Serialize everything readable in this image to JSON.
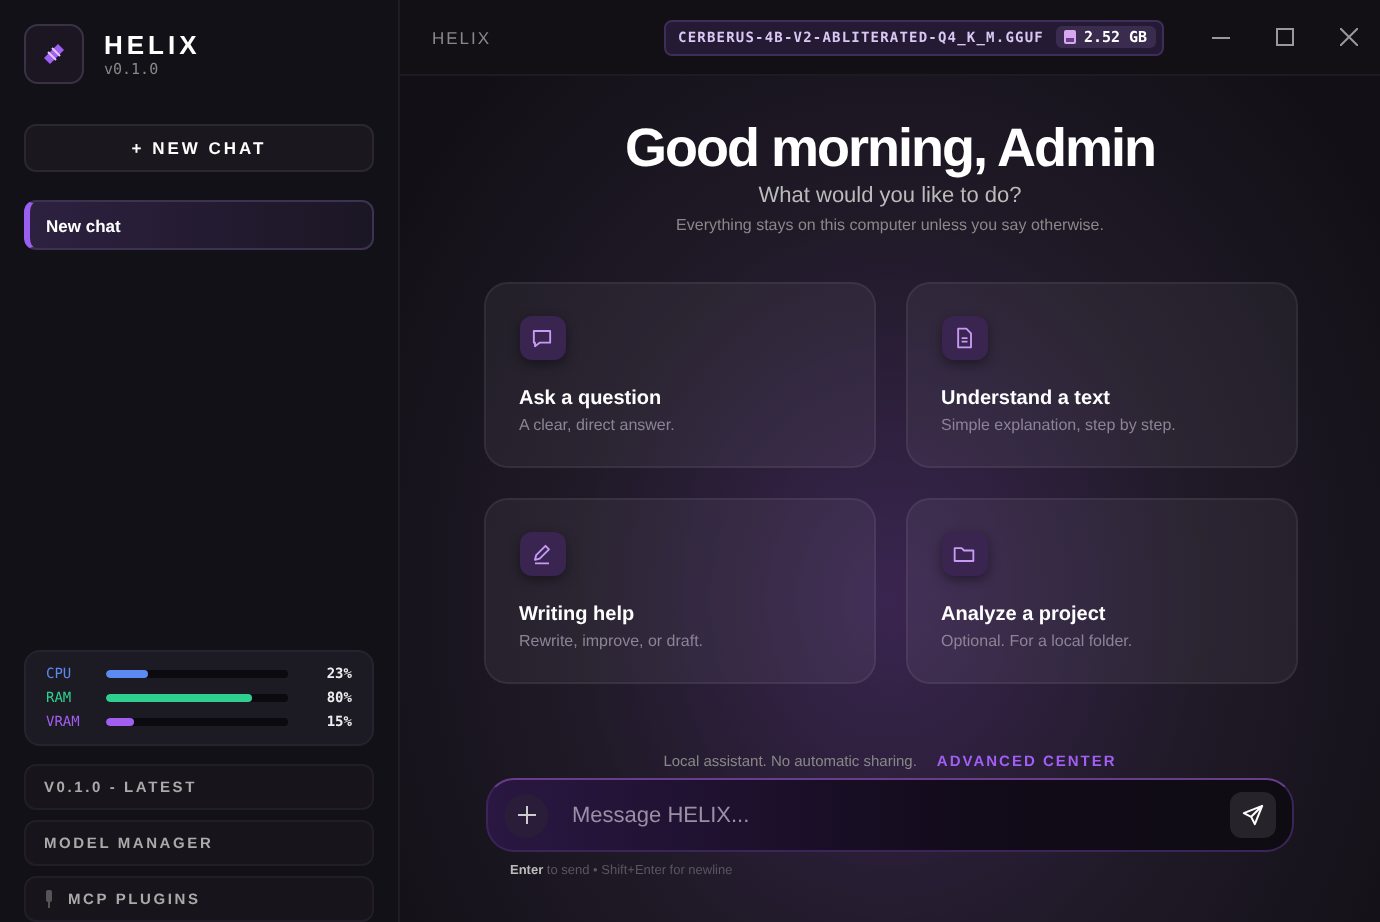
{
  "app": {
    "name": "HELIX",
    "version": "v0.1.0"
  },
  "sidebar": {
    "new_chat_button": "+ NEW CHAT",
    "chats": [
      {
        "title": "New chat",
        "selected": true
      }
    ],
    "resources": [
      {
        "name": "CPU",
        "level": 0.23,
        "reading": "23%",
        "color": "#5b8af0"
      },
      {
        "name": "RAM",
        "level": 0.8,
        "reading": "80%",
        "color": "#2fd08f"
      },
      {
        "name": "VRAM",
        "level": 0.15,
        "reading": "15%",
        "color": "#a15ef0"
      }
    ],
    "links": [
      {
        "label": "V0.1.0 - LATEST",
        "kind": "plain"
      },
      {
        "label": "MODEL MANAGER",
        "kind": "plain"
      },
      {
        "label": "MCP PLUGINS",
        "kind": "plugin"
      }
    ]
  },
  "titlebar": {
    "title": "HELIX",
    "model": "CERBERUS-4B-V2-ABLITERATED-Q4_K_M.GGUF",
    "model_size": "2.52 GB"
  },
  "greeting": {
    "title": "Good morning, Admin",
    "subtitle": "What would you like to do?",
    "note": "Everything stays on this computer unless you say otherwise."
  },
  "cards": [
    {
      "kind": "chat",
      "title": "Ask a question",
      "subtitle": "A clear, direct answer."
    },
    {
      "kind": "document",
      "title": "Understand a text",
      "subtitle": "Simple explanation, step by step."
    },
    {
      "kind": "pencil",
      "title": "Writing help",
      "subtitle": "Rewrite, improve, or draft."
    },
    {
      "kind": "folder",
      "title": "Analyze a project",
      "subtitle": "Optional. For a local folder."
    }
  ],
  "footer_note": {
    "text": "Local assistant. No automatic sharing.",
    "link": "ADVANCED CENTER"
  },
  "composer": {
    "placeholder": "Message HELIX..."
  },
  "hint": "**Enter** to send • Shift+Enter for newline"
}
